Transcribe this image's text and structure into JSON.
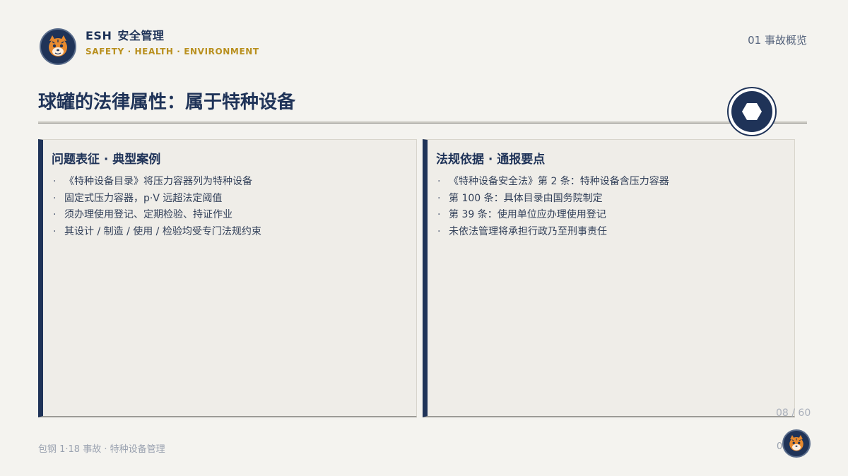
{
  "header": {
    "brand": "ESH",
    "brand_cn": "安全管理",
    "subtitle": "SAFETY · HEALTH · ENVIRONMENT",
    "section": "01  事故概览"
  },
  "title": "球罐的法律属性：属于特种设备",
  "badge_icon": "hexagon-icon",
  "panels": [
    {
      "heading": "问题表征 · 典型案例",
      "bullets": [
        "《特种设备目录》将压力容器列为特种设备",
        "固定式压力容器，p·V 远超法定阈值",
        "须办理使用登记、定期检验、持证作业",
        "其设计 / 制造 / 使用 / 检验均受专门法规约束"
      ]
    },
    {
      "heading": "法规依据 · 通报要点",
      "bullets": [
        "《特种设备安全法》第 2 条：特种设备含压力容器",
        "第 100 条：具体目录由国务院制定",
        "第 39 条：使用单位应办理使用登记",
        "未依法管理将承担行政乃至刑事责任"
      ]
    }
  ],
  "bullet_glyph": "·",
  "page_counter": "08 / 60",
  "footer": {
    "text": "包钢 1·18 事故 · 特种设备管理",
    "page_num": "0"
  },
  "colors": {
    "navy": "#1f3358",
    "gold": "#b9901f",
    "background": "#f4f3ef",
    "panel": "#efede8",
    "tiger_orange": "#e88a2e"
  }
}
